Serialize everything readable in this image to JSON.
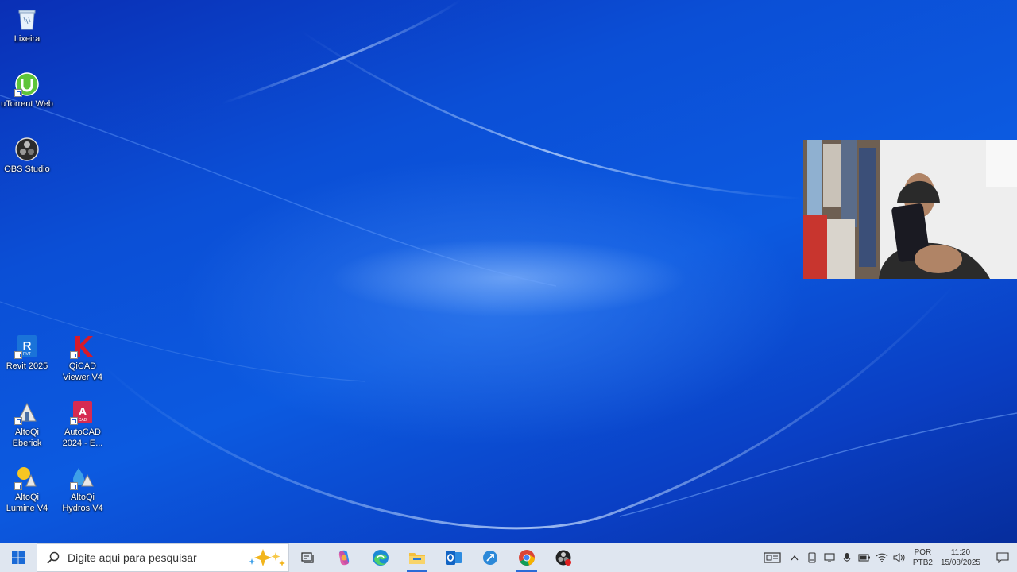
{
  "desktop": {
    "icons": [
      {
        "label": "Lixeira",
        "icon": "recycle-bin-icon"
      },
      {
        "label": "uTorrent Web",
        "icon": "utorrent-icon"
      },
      {
        "label": "OBS Studio",
        "icon": "obs-studio-icon"
      },
      {
        "label": "Revit 2025",
        "icon": "revit-icon"
      },
      {
        "label": "QiCAD\nViewer V4",
        "icon": "qicad-viewer-icon"
      },
      {
        "label": "AltoQi\nEberick",
        "icon": "altoqi-eberick-icon"
      },
      {
        "label": "AutoCAD\n2024 - E...",
        "icon": "autocad-icon"
      },
      {
        "label": "AltoQi\nLumine V4",
        "icon": "altoqi-lumine-icon"
      },
      {
        "label": "AltoQi\nHydros V4",
        "icon": "altoqi-hydros-icon"
      }
    ]
  },
  "taskbar": {
    "search_placeholder": "Digite aqui para pesquisar",
    "apps": [
      "start-icon",
      "task-view-icon",
      "copilot-icon",
      "edge-icon",
      "file-explorer-icon",
      "outlook-icon",
      "quick-assist-icon",
      "chrome-icon",
      "obs-icon"
    ],
    "active_apps": [
      "file-explorer-icon",
      "chrome-icon"
    ],
    "tray": {
      "language": "POR",
      "keyboard": "PTB2",
      "time": "11:20",
      "date": "15/08/2025"
    }
  },
  "colors": {
    "wallpaper": "#0b4fd6",
    "taskbar": "#dfe6f0",
    "accent": "#2a6bd8"
  }
}
